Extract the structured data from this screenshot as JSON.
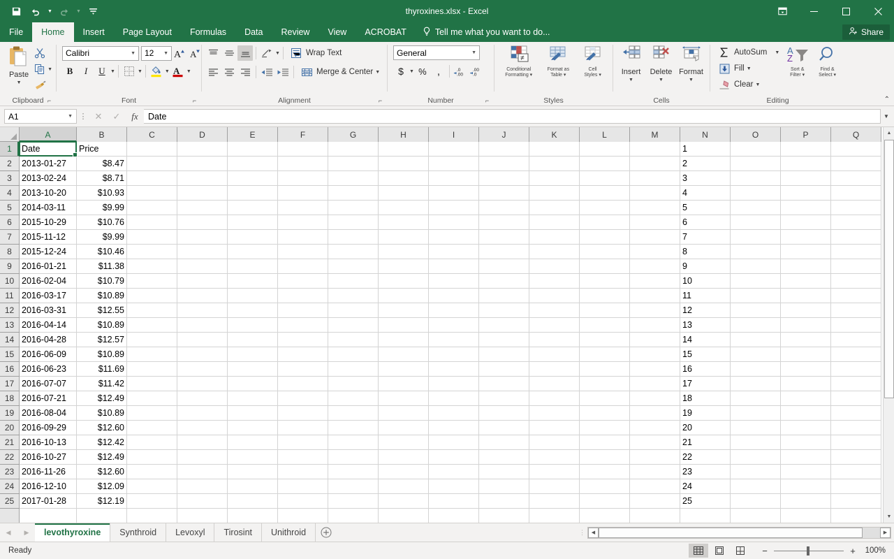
{
  "titlebar": {
    "document_title": "thyroxines.xlsx - Excel",
    "qat": [
      {
        "name": "save-icon",
        "label": "Save",
        "state": "enabled"
      },
      {
        "name": "undo-icon",
        "label": "Undo",
        "state": "enabled"
      },
      {
        "name": "redo-icon",
        "label": "Redo",
        "state": "disabled"
      },
      {
        "name": "customize-qat-icon",
        "label": "Customize Quick Access Toolbar",
        "state": "enabled"
      }
    ],
    "ribbon_display_options": "Ribbon Display Options",
    "minimize": "Minimize",
    "maximize": "Restore Down",
    "close": "Close"
  },
  "ribbon_tabs": [
    {
      "label": "File",
      "active": false
    },
    {
      "label": "Home",
      "active": true
    },
    {
      "label": "Insert",
      "active": false
    },
    {
      "label": "Page Layout",
      "active": false
    },
    {
      "label": "Formulas",
      "active": false
    },
    {
      "label": "Data",
      "active": false
    },
    {
      "label": "Review",
      "active": false
    },
    {
      "label": "View",
      "active": false
    },
    {
      "label": "ACROBAT",
      "active": false
    }
  ],
  "tellme": {
    "label": "Tell me what you want to do..."
  },
  "share": {
    "label": "Share"
  },
  "ribbon": {
    "clipboard": {
      "group_label": "Clipboard",
      "paste_label": "Paste",
      "cut_label": "Cut",
      "copy_label": "Copy",
      "format_painter_label": "Format Painter"
    },
    "font": {
      "group_label": "Font",
      "font_name": "Calibri",
      "font_size": "12",
      "grow_font": "Increase Font Size",
      "shrink_font": "Decrease Font Size",
      "bold": "B",
      "italic": "I",
      "underline": "U",
      "borders": "Borders",
      "fill_color": "Fill Color",
      "font_color": "Font Color"
    },
    "alignment": {
      "group_label": "Alignment",
      "wrap_text_label": "Wrap Text",
      "merge_center_label": "Merge & Center",
      "orientation": "Orientation",
      "decrease_indent": "Decrease Indent",
      "increase_indent": "Increase Indent"
    },
    "number": {
      "group_label": "Number",
      "format_value": "General",
      "accounting": "$",
      "percent": "%",
      "comma": ",",
      "increase_decimal": "Increase Decimal",
      "decrease_decimal": "Decrease Decimal"
    },
    "styles": {
      "group_label": "Styles",
      "conditional_formatting": "Conditional\nFormatting",
      "conditional_formatting_l1": "Conditional",
      "conditional_formatting_l2": "Formatting",
      "format_as_table_l1": "Format as",
      "format_as_table_l2": "Table",
      "cell_styles_l1": "Cell",
      "cell_styles_l2": "Styles"
    },
    "cells": {
      "group_label": "Cells",
      "insert": "Insert",
      "delete": "Delete",
      "format": "Format"
    },
    "editing": {
      "group_label": "Editing",
      "autosum": "AutoSum",
      "fill": "Fill",
      "clear": "Clear",
      "sort_filter_l1": "Sort &",
      "sort_filter_l2": "Filter",
      "find_select_l1": "Find &",
      "find_select_l2": "Select",
      "collapse_ribbon": "Collapse the Ribbon"
    }
  },
  "formulabar": {
    "name_box_value": "A1",
    "cancel_icon": "✕",
    "enter_icon": "✓",
    "function_icon": "fx",
    "formula_value": "Date"
  },
  "grid": {
    "columns": [
      "A",
      "B",
      "C",
      "D",
      "E",
      "F",
      "G",
      "H",
      "I",
      "J",
      "K",
      "L",
      "M",
      "N",
      "O",
      "P",
      "Q"
    ],
    "selected_column": "A",
    "selected_row": 1,
    "active_cell": "A1",
    "rows": [
      {
        "n": 1,
        "a": "Date",
        "b": "Price"
      },
      {
        "n": 2,
        "a": "2013-01-27",
        "b": "$8.47"
      },
      {
        "n": 3,
        "a": "2013-02-24",
        "b": "$8.71"
      },
      {
        "n": 4,
        "a": "2013-10-20",
        "b": "$10.93"
      },
      {
        "n": 5,
        "a": "2014-03-11",
        "b": "$9.99"
      },
      {
        "n": 6,
        "a": "2015-10-29",
        "b": "$10.76"
      },
      {
        "n": 7,
        "a": "2015-11-12",
        "b": "$9.99"
      },
      {
        "n": 8,
        "a": "2015-12-24",
        "b": "$10.46"
      },
      {
        "n": 9,
        "a": "2016-01-21",
        "b": "$11.38"
      },
      {
        "n": 10,
        "a": "2016-02-04",
        "b": "$10.79"
      },
      {
        "n": 11,
        "a": "2016-03-17",
        "b": "$10.89"
      },
      {
        "n": 12,
        "a": "2016-03-31",
        "b": "$12.55"
      },
      {
        "n": 13,
        "a": "2016-04-14",
        "b": "$10.89"
      },
      {
        "n": 14,
        "a": "2016-04-28",
        "b": "$12.57"
      },
      {
        "n": 15,
        "a": "2016-06-09",
        "b": "$10.89"
      },
      {
        "n": 16,
        "a": "2016-06-23",
        "b": "$11.69"
      },
      {
        "n": 17,
        "a": "2016-07-07",
        "b": "$11.42"
      },
      {
        "n": 18,
        "a": "2016-07-21",
        "b": "$12.49"
      },
      {
        "n": 19,
        "a": "2016-08-04",
        "b": "$10.89"
      },
      {
        "n": 20,
        "a": "2016-09-29",
        "b": "$12.60"
      },
      {
        "n": 21,
        "a": "2016-10-13",
        "b": "$12.42"
      },
      {
        "n": 22,
        "a": "2016-10-27",
        "b": "$12.49"
      },
      {
        "n": 23,
        "a": "2016-11-26",
        "b": "$12.60"
      },
      {
        "n": 24,
        "a": "2016-12-10",
        "b": "$12.09"
      },
      {
        "n": 25,
        "a": "2017-01-28",
        "b": "$12.19"
      }
    ]
  },
  "sheettabs": {
    "prev": "Previous Sheet",
    "next": "Next Sheet",
    "tabs": [
      {
        "label": "levothyroxine",
        "active": true
      },
      {
        "label": "Synthroid",
        "active": false
      },
      {
        "label": "Levoxyl",
        "active": false
      },
      {
        "label": "Tirosint",
        "active": false
      },
      {
        "label": "Unithroid",
        "active": false
      }
    ],
    "add_sheet": "+"
  },
  "statusbar": {
    "status_text": "Ready",
    "views": [
      {
        "name": "normal-view-icon",
        "label": "Normal",
        "selected": true
      },
      {
        "name": "page-layout-view-icon",
        "label": "Page Layout",
        "selected": false
      },
      {
        "name": "page-break-preview-icon",
        "label": "Page Break Preview",
        "selected": false
      }
    ],
    "zoom_out": "−",
    "zoom_in": "+",
    "zoom_level": "100%"
  },
  "colors": {
    "brand_green": "#217346",
    "ribbon_bg": "#f3f2f1",
    "grid_line": "#d4d4d4",
    "header_bg": "#e6e6e6"
  }
}
